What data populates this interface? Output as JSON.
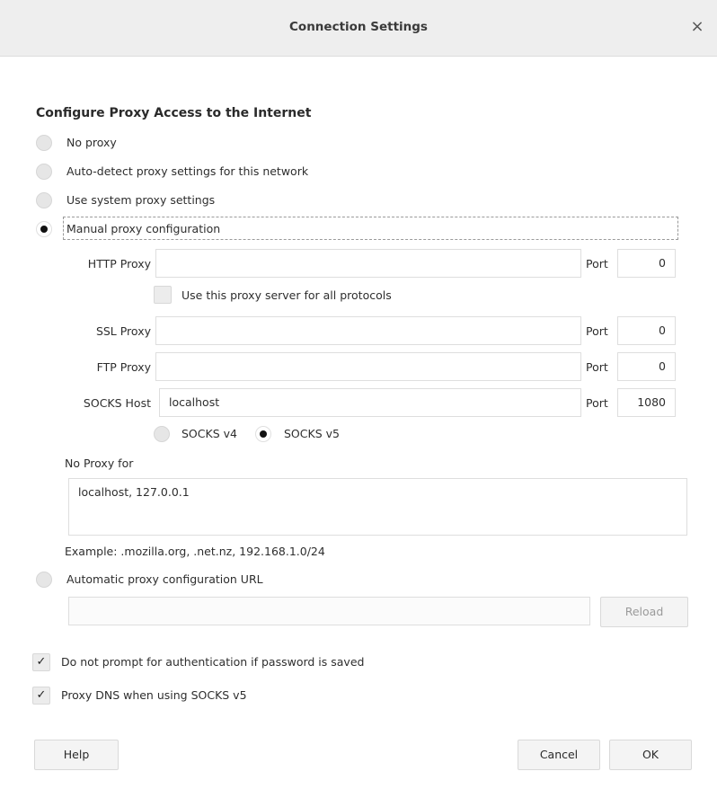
{
  "window": {
    "title": "Connection Settings",
    "close_glyph": "×"
  },
  "heading": "Configure Proxy Access to the Internet",
  "proxy_modes": {
    "no_proxy": "No proxy",
    "auto_detect": "Auto-detect proxy settings for this network",
    "system": "Use system proxy settings",
    "manual": "Manual proxy configuration",
    "selected": "manual"
  },
  "manual": {
    "http_label": "HTTP Proxy",
    "http_value": "",
    "http_port_label": "Port",
    "http_port": "0",
    "all_protocols_label": "Use this proxy server for all protocols",
    "all_protocols_checked": false,
    "ssl_label": "SSL Proxy",
    "ssl_value": "",
    "ssl_port_label": "Port",
    "ssl_port": "0",
    "ftp_label": "FTP Proxy",
    "ftp_value": "",
    "ftp_port_label": "Port",
    "ftp_port": "0",
    "socks_label": "SOCKS Host",
    "socks_value": "localhost",
    "socks_port_label": "Port",
    "socks_port": "1080",
    "socks_v4_label": "SOCKS v4",
    "socks_v5_label": "SOCKS v5",
    "socks_version_selected": "v5"
  },
  "no_proxy": {
    "label": "No Proxy for",
    "value": "localhost, 127.0.0.1",
    "example": "Example: .mozilla.org, .net.nz, 192.168.1.0/24"
  },
  "auto_config": {
    "label": "Automatic proxy configuration URL",
    "url_value": "",
    "reload_label": "Reload"
  },
  "options": {
    "no_auth_prompt_label": "Do not prompt for authentication if password is saved",
    "no_auth_prompt_checked": true,
    "proxy_dns_label": "Proxy DNS when using SOCKS v5",
    "proxy_dns_checked": true
  },
  "buttons": {
    "help": "Help",
    "cancel": "Cancel",
    "ok": "OK"
  },
  "icons": {
    "check_glyph": "✓"
  }
}
